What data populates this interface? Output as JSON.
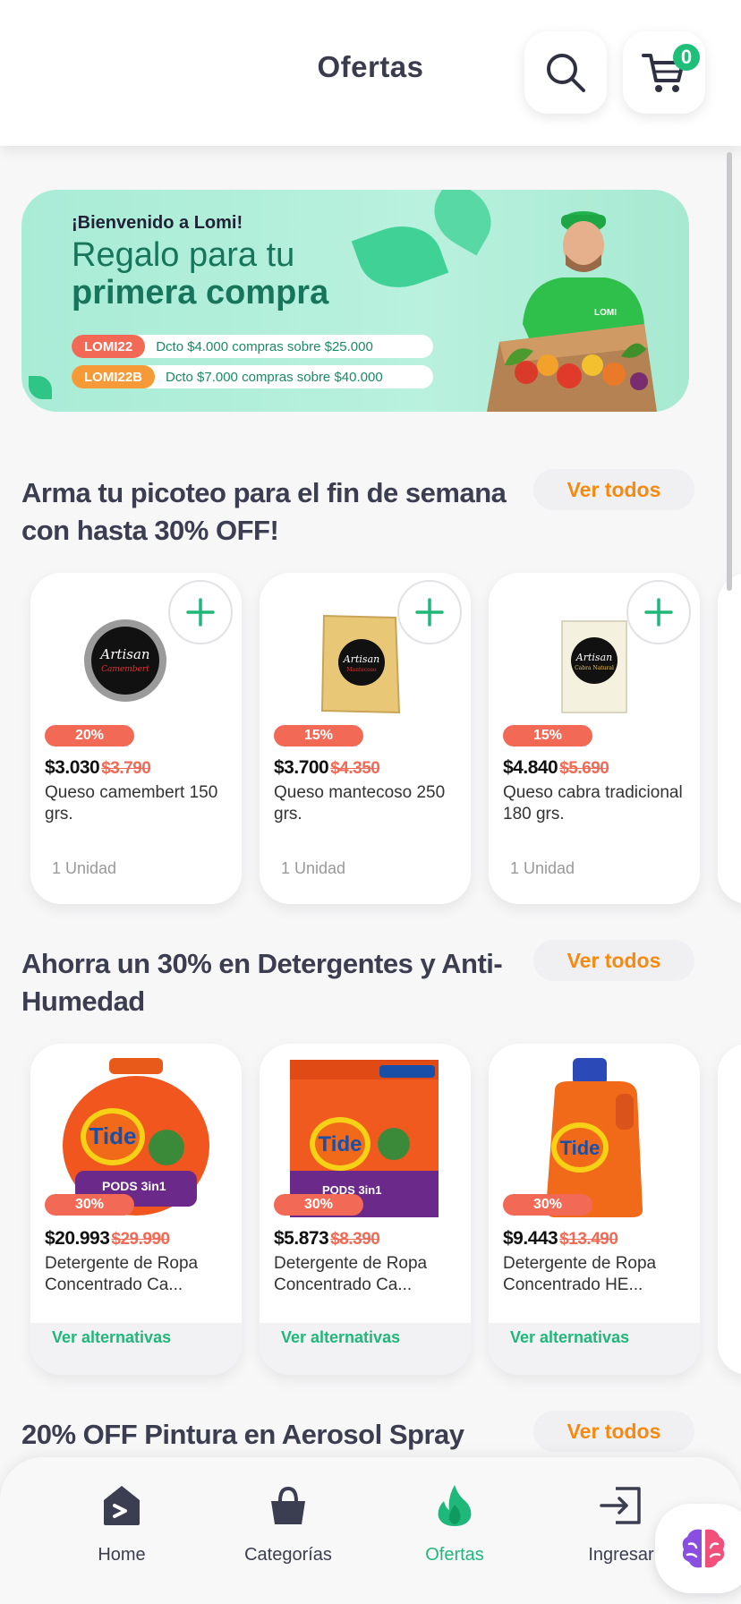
{
  "header": {
    "title": "Ofertas",
    "cart_count": "0"
  },
  "banner": {
    "welcome": "¡Bienvenido a Lomi!",
    "title_line1": "Regalo para tu",
    "title_line2": "primera compra",
    "shirt_logo": "LOMI",
    "promos": [
      {
        "code": "LOMI22",
        "text": "Dcto $4.000 compras sobre $25.000",
        "color": "#f26a55"
      },
      {
        "code": "LOMI22B",
        "text": "Dcto $7.000 compras sobre $40.000",
        "color": "#f59a36"
      }
    ]
  },
  "sections": [
    {
      "title": "Arma tu picoteo para el fin de semana con hasta 30% OFF!",
      "see_all": "Ver todos",
      "products": [
        {
          "discount": "20%",
          "price": "$3.030",
          "old_price": "$3.790",
          "name": "Queso camembert 150 grs.",
          "unit": "1 Unidad",
          "image_icon": "cheese-camembert-icon"
        },
        {
          "discount": "15%",
          "price": "$3.700",
          "old_price": "$4.350",
          "name": "Queso mantecoso 250 grs.",
          "unit": "1 Unidad",
          "image_icon": "cheese-mantecoso-icon"
        },
        {
          "discount": "15%",
          "price": "$4.840",
          "old_price": "$5.690",
          "name": "Queso cabra tradicional 180 grs.",
          "unit": "1 Unidad",
          "image_icon": "cheese-goat-icon"
        }
      ]
    },
    {
      "title": "Ahorra un 30% en Detergentes y Anti-Humedad",
      "see_all": "Ver todos",
      "products": [
        {
          "discount": "30%",
          "price": "$20.993",
          "old_price": "$29.990",
          "name": "Detergente de Ropa Concentrado Ca...",
          "action": "Ver alternativas",
          "image_icon": "tide-pods-tub-icon"
        },
        {
          "discount": "30%",
          "price": "$5.873",
          "old_price": "$8.390",
          "name": "Detergente de Ropa Concentrado Ca...",
          "action": "Ver alternativas",
          "image_icon": "tide-pods-bag-icon"
        },
        {
          "discount": "30%",
          "price": "$9.443",
          "old_price": "$13.490",
          "name": "Detergente de Ropa Concentrado HE...",
          "action": "Ver alternativas",
          "image_icon": "tide-bottle-icon"
        }
      ]
    },
    {
      "title": "20% OFF Pintura en Aerosol Spray",
      "see_all": "Ver todos"
    }
  ],
  "nav": [
    {
      "label": "Home",
      "icon": "home-icon"
    },
    {
      "label": "Categorías",
      "icon": "basket-icon"
    },
    {
      "label": "Ofertas",
      "icon": "flame-icon",
      "active": true
    },
    {
      "label": "Ingresar",
      "icon": "login-icon"
    }
  ],
  "colors": {
    "accent_green": "#1fb77a",
    "discount_red": "#f26a55",
    "see_all_orange": "#f58a11"
  }
}
